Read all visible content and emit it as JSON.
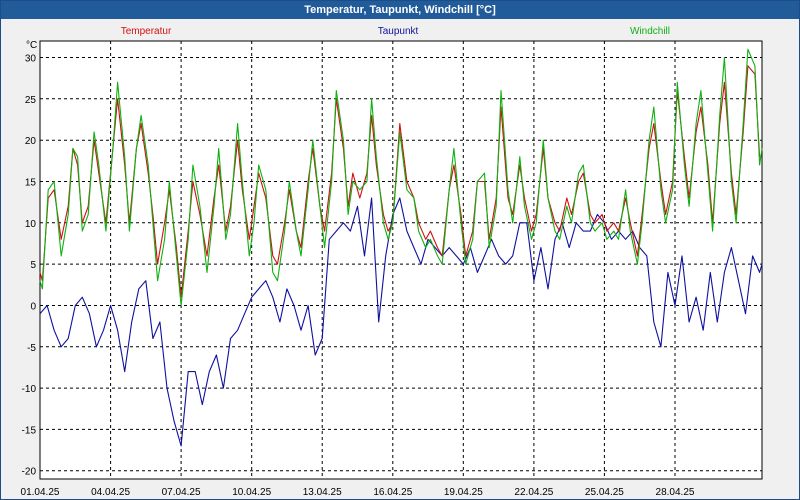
{
  "window": {
    "title": "Temperatur, Taupunkt, Windchill [°C]"
  },
  "chart_data": {
    "type": "line",
    "title": "Temperatur, Taupunkt, Windchill [°C]",
    "ylabel": "°C",
    "ylim": [
      -21,
      32
    ],
    "yticks": [
      -20,
      -15,
      -10,
      -5,
      0,
      5,
      10,
      15,
      20,
      25,
      30
    ],
    "xlim": [
      0,
      30.7
    ],
    "xticks": [
      {
        "x": 0,
        "label": "01.04.25"
      },
      {
        "x": 3,
        "label": "04.04.25"
      },
      {
        "x": 6,
        "label": "07.04.25"
      },
      {
        "x": 9,
        "label": "10.04.25"
      },
      {
        "x": 12,
        "label": "13.04.25"
      },
      {
        "x": 15,
        "label": "16.04.25"
      },
      {
        "x": 18,
        "label": "19.04.25"
      },
      {
        "x": 21,
        "label": "22.04.25"
      },
      {
        "x": 24,
        "label": "25.04.25"
      },
      {
        "x": 27,
        "label": "28.04.25"
      }
    ],
    "grid": true,
    "legend": "top",
    "series": [
      {
        "name": "Temperatur",
        "color": "#d01010",
        "x": [
          0,
          0.1,
          0.35,
          0.6,
          0.9,
          1.2,
          1.4,
          1.6,
          1.8,
          2.05,
          2.3,
          2.5,
          2.8,
          3.1,
          3.3,
          3.6,
          3.8,
          4.1,
          4.3,
          4.6,
          4.8,
          5.0,
          5.3,
          5.5,
          5.8,
          6.0,
          6.3,
          6.5,
          6.8,
          7.1,
          7.4,
          7.6,
          7.9,
          8.1,
          8.4,
          8.6,
          8.9,
          9.1,
          9.3,
          9.6,
          9.9,
          10.1,
          10.4,
          10.6,
          10.9,
          11.1,
          11.4,
          11.6,
          11.9,
          12.1,
          12.4,
          12.6,
          12.9,
          13.1,
          13.3,
          13.6,
          13.9,
          14.1,
          14.3,
          14.6,
          14.8,
          15.0,
          15.3,
          15.6,
          15.9,
          16.1,
          16.4,
          16.6,
          16.9,
          17.1,
          17.4,
          17.6,
          17.9,
          18.1,
          18.4,
          18.6,
          18.9,
          19.1,
          19.4,
          19.6,
          19.9,
          20.1,
          20.4,
          20.6,
          20.9,
          21.1,
          21.4,
          21.6,
          21.9,
          22.1,
          22.4,
          22.6,
          22.9,
          23.1,
          23.4,
          23.6,
          23.9,
          24.1,
          24.4,
          24.6,
          24.9,
          25.1,
          25.4,
          25.6,
          25.9,
          26.1,
          26.4,
          26.6,
          26.9,
          27.1,
          27.4,
          27.6,
          27.9,
          28.1,
          28.4,
          28.6,
          28.9,
          29.1,
          29.4,
          29.6,
          29.9,
          30.1,
          30.4,
          30.6,
          30.7
        ],
        "values": [
          4,
          3,
          13,
          14,
          8,
          12,
          19,
          17,
          10,
          12,
          20,
          16,
          10,
          19,
          25,
          17,
          10,
          19,
          22,
          16,
          11,
          5,
          10,
          14,
          7,
          1,
          9,
          15,
          11,
          6,
          13,
          17,
          9,
          12,
          20,
          14,
          8,
          12,
          16,
          13,
          6,
          5,
          10,
          14,
          9,
          7,
          15,
          19,
          12,
          9,
          16,
          25,
          19,
          12,
          16,
          13,
          16,
          23,
          17,
          11,
          9,
          10,
          22,
          15,
          13,
          10,
          8,
          9,
          7,
          6,
          14,
          17,
          11,
          6,
          9,
          15,
          15,
          8,
          13,
          24,
          13,
          11,
          17,
          13,
          9,
          11,
          19,
          13,
          10,
          9,
          13,
          11,
          15,
          16,
          11,
          10,
          11,
          9,
          10,
          9,
          13,
          10,
          6,
          11,
          19,
          22,
          15,
          11,
          15,
          26,
          18,
          13,
          21,
          24,
          17,
          10,
          22,
          27,
          16,
          11,
          21,
          29,
          28,
          18,
          18
        ]
      },
      {
        "name": "Taupunkt",
        "color": "#1010a0",
        "x": [
          0,
          0.3,
          0.6,
          0.9,
          1.2,
          1.5,
          1.8,
          2.1,
          2.4,
          2.7,
          3.0,
          3.3,
          3.6,
          3.9,
          4.2,
          4.5,
          4.8,
          5.1,
          5.4,
          5.7,
          6.0,
          6.3,
          6.6,
          6.9,
          7.2,
          7.5,
          7.8,
          8.1,
          8.4,
          8.7,
          9.0,
          9.3,
          9.6,
          9.9,
          10.2,
          10.5,
          10.8,
          11.1,
          11.4,
          11.7,
          12.0,
          12.3,
          12.6,
          12.9,
          13.2,
          13.5,
          13.8,
          14.1,
          14.4,
          14.7,
          15.0,
          15.3,
          15.6,
          15.9,
          16.2,
          16.5,
          16.8,
          17.1,
          17.4,
          17.7,
          18.0,
          18.3,
          18.6,
          18.9,
          19.2,
          19.5,
          19.8,
          20.1,
          20.4,
          20.7,
          21.0,
          21.3,
          21.6,
          21.9,
          22.2,
          22.5,
          22.8,
          23.1,
          23.4,
          23.7,
          24.0,
          24.3,
          24.6,
          24.9,
          25.2,
          25.5,
          25.8,
          26.1,
          26.4,
          26.7,
          27.0,
          27.3,
          27.6,
          27.9,
          28.2,
          28.5,
          28.8,
          29.1,
          29.4,
          29.7,
          30.0,
          30.3,
          30.6,
          30.7
        ],
        "values": [
          -1,
          0,
          -3,
          -5,
          -4,
          0,
          1,
          -1,
          -5,
          -3,
          0,
          -3,
          -8,
          -2,
          2,
          3,
          -4,
          -2,
          -10,
          -14,
          -17,
          -8,
          -8,
          -12,
          -8,
          -6,
          -10,
          -4,
          -3,
          -1,
          1,
          2,
          3,
          1,
          -2,
          2,
          0,
          -3,
          0,
          -6,
          -4,
          8,
          9,
          10,
          9,
          12,
          6,
          13,
          -2,
          6,
          11,
          13,
          9,
          7,
          5,
          8,
          7,
          6,
          7,
          6,
          5,
          7,
          4,
          6,
          8,
          6,
          5,
          6,
          10,
          10,
          3,
          7,
          2,
          8,
          10,
          7,
          10,
          9,
          9,
          11,
          10,
          8,
          9,
          8,
          9,
          7,
          6,
          -2,
          -5,
          4,
          0,
          6,
          -2,
          1,
          -3,
          4,
          -2,
          4,
          7,
          3,
          -1,
          6,
          4,
          5
        ]
      },
      {
        "name": "Windchill",
        "color": "#10b010",
        "x": [
          0,
          0.1,
          0.35,
          0.6,
          0.9,
          1.2,
          1.4,
          1.6,
          1.8,
          2.05,
          2.3,
          2.5,
          2.8,
          3.1,
          3.3,
          3.6,
          3.8,
          4.1,
          4.3,
          4.6,
          4.8,
          5.0,
          5.3,
          5.5,
          5.8,
          6.0,
          6.3,
          6.5,
          6.8,
          7.1,
          7.4,
          7.6,
          7.9,
          8.1,
          8.4,
          8.6,
          8.9,
          9.1,
          9.3,
          9.6,
          9.9,
          10.1,
          10.4,
          10.6,
          10.9,
          11.1,
          11.4,
          11.6,
          11.9,
          12.1,
          12.4,
          12.6,
          12.9,
          13.1,
          13.3,
          13.6,
          13.9,
          14.1,
          14.3,
          14.6,
          14.8,
          15.0,
          15.3,
          15.6,
          15.9,
          16.1,
          16.4,
          16.6,
          16.9,
          17.1,
          17.4,
          17.6,
          17.9,
          18.1,
          18.4,
          18.6,
          18.9,
          19.1,
          19.4,
          19.6,
          19.9,
          20.1,
          20.4,
          20.6,
          20.9,
          21.1,
          21.4,
          21.6,
          21.9,
          22.1,
          22.4,
          22.6,
          22.9,
          23.1,
          23.4,
          23.6,
          23.9,
          24.1,
          24.4,
          24.6,
          24.9,
          25.1,
          25.4,
          25.6,
          25.9,
          26.1,
          26.4,
          26.6,
          26.9,
          27.1,
          27.4,
          27.6,
          27.9,
          28.1,
          28.4,
          28.6,
          28.9,
          29.1,
          29.4,
          29.6,
          29.9,
          30.1,
          30.4,
          30.6,
          30.7
        ],
        "values": [
          3,
          2,
          14,
          15,
          6,
          11,
          19,
          18,
          9,
          11,
          21,
          17,
          9,
          19,
          27,
          18,
          9,
          19,
          23,
          17,
          10,
          3,
          8,
          15,
          6,
          0,
          8,
          17,
          12,
          4,
          12,
          19,
          8,
          11,
          22,
          15,
          6,
          10,
          17,
          14,
          4,
          3,
          9,
          15,
          9,
          6,
          14,
          20,
          12,
          7,
          15,
          26,
          20,
          11,
          15,
          14,
          15,
          25,
          18,
          10,
          8,
          10,
          21,
          14,
          13,
          9,
          7,
          8,
          6,
          5,
          14,
          19,
          10,
          5,
          8,
          15,
          16,
          7,
          12,
          26,
          14,
          10,
          18,
          12,
          8,
          10,
          20,
          13,
          9,
          8,
          12,
          10,
          16,
          17,
          10,
          9,
          10,
          8,
          9,
          8,
          14,
          9,
          5,
          10,
          20,
          24,
          14,
          10,
          14,
          27,
          17,
          12,
          22,
          26,
          16,
          9,
          23,
          30,
          15,
          10,
          22,
          31,
          29,
          17,
          19
        ]
      }
    ]
  }
}
